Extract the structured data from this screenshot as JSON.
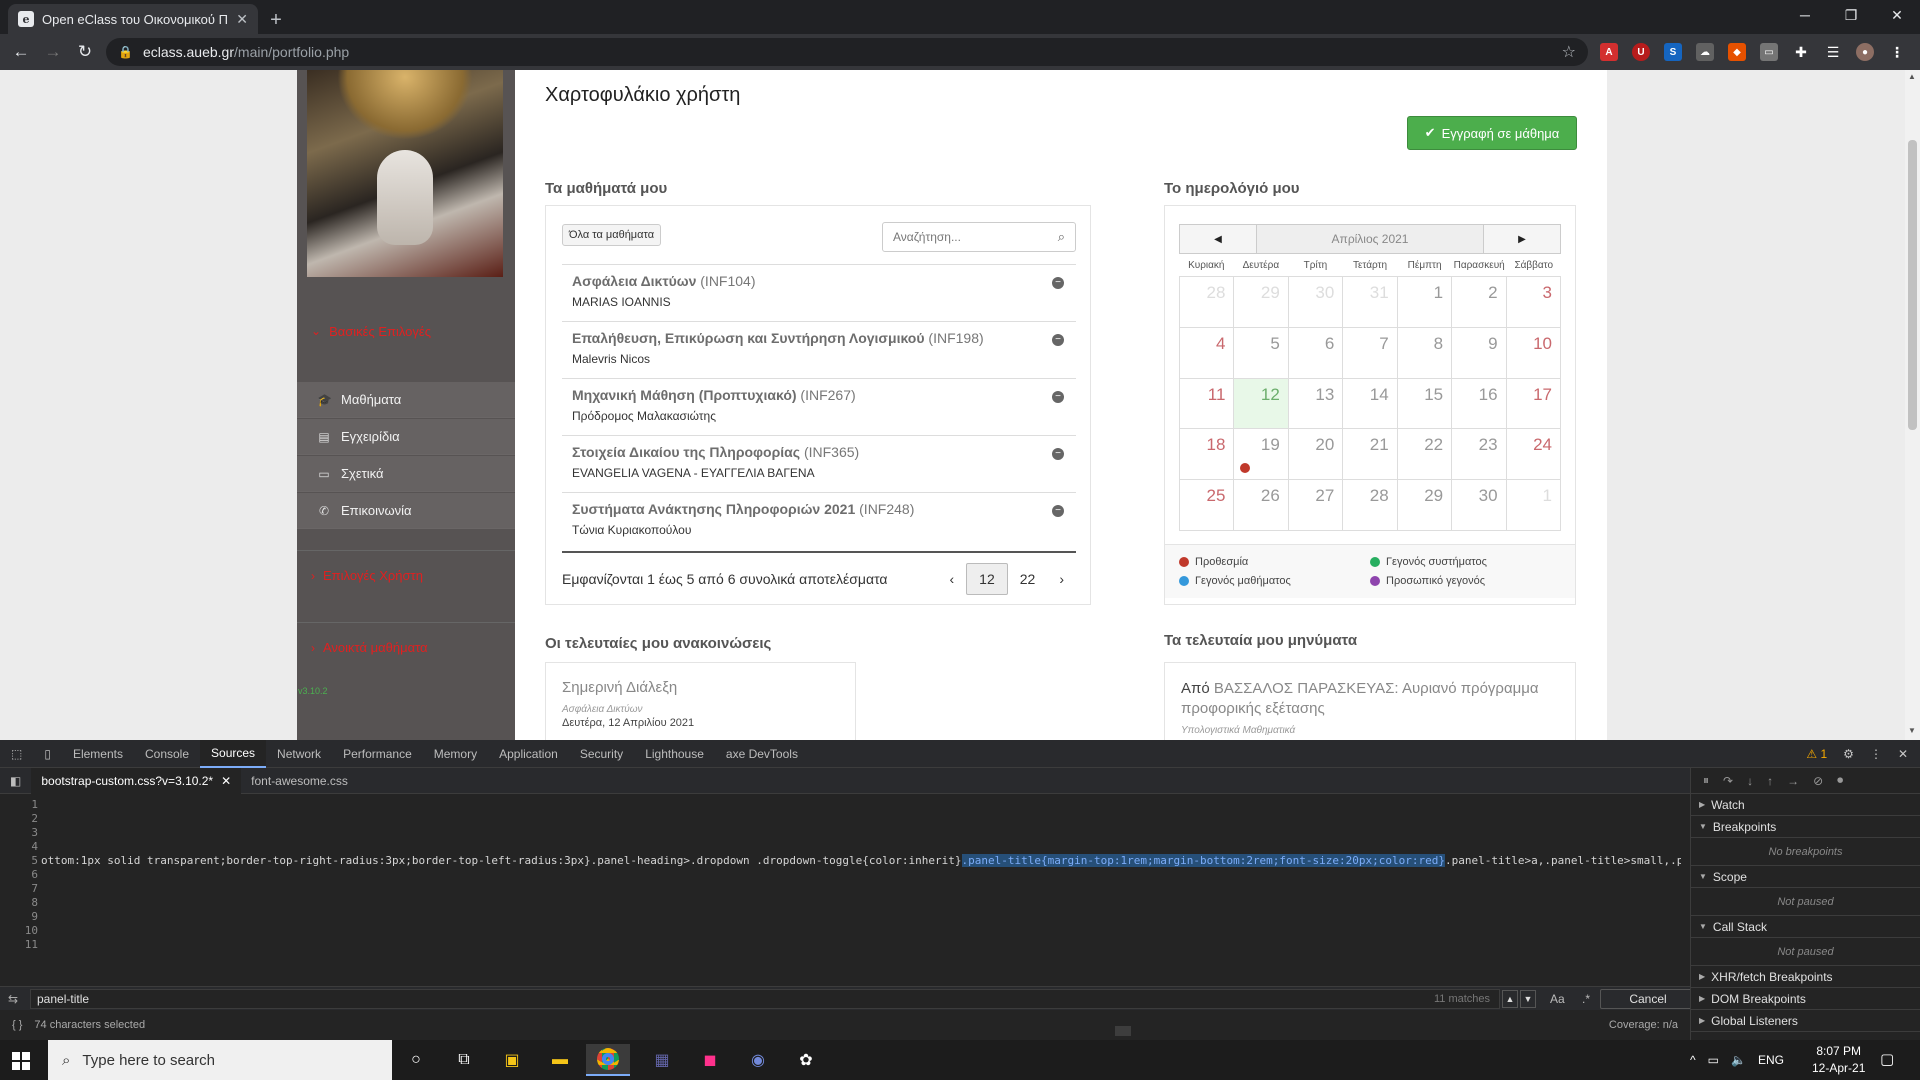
{
  "browser": {
    "tab_title": "Open eClass του Οικονομικού Π",
    "favicon_letter": "e",
    "url_host": "eclass.aueb.gr",
    "url_path": "/main/portfolio.php"
  },
  "sidebar": {
    "section_basic": "Βασικές Επιλογές",
    "items": [
      {
        "label": "Μαθήματα",
        "icon": "graduation-cap-icon"
      },
      {
        "label": "Εγχειρίδια",
        "icon": "book-icon"
      },
      {
        "label": "Σχετικά",
        "icon": "credit-card-icon"
      },
      {
        "label": "Επικοινωνία",
        "icon": "phone-icon"
      }
    ],
    "section_user": "Επιλογές Χρήστη",
    "section_open": "Ανοικτά μαθήματα",
    "version": "v3.10.2"
  },
  "main": {
    "page_title": "Χαρτοφυλάκιο χρήστη",
    "enroll_button": "Εγγραφή σε μάθημα",
    "my_courses_heading": "Τα μαθήματά μου",
    "all_courses_button": "Όλα τα μαθήματα",
    "search_placeholder": "Αναζήτηση...",
    "courses": [
      {
        "title": "Ασφάλεια Δικτύων",
        "code": "(INF104)",
        "professor": "MARIAS IOANNIS"
      },
      {
        "title": "Επαλήθευση, Επικύρωση και Συντήρηση Λογισμικού",
        "code": "(INF198)",
        "professor": "Malevris Nicos"
      },
      {
        "title": "Μηχανική Μάθηση (Προπτυχιακό)",
        "code": "(INF267)",
        "professor": "Πρόδρομος Μαλακασιώτης"
      },
      {
        "title": "Στοιχεία Δικαίου της Πληροφορίας",
        "code": "(INF365)",
        "professor": "EVANGELIA VAGENA - ΕΥΑΓΓΕΛΙΑ ΒΑΓΕΝΑ"
      },
      {
        "title": "Συστήματα Ανάκτησης Πληροφοριών 2021",
        "code": "(INF248)",
        "professor": "Τώνια Κυριακοπούλου"
      }
    ],
    "results_text": "Εμφανίζονται 1 έως 5 από 6 συνολικά αποτελέσματα",
    "pagination": {
      "prev": "‹",
      "page1": "12",
      "page2": "22",
      "next": "›"
    },
    "calendar_heading": "Το ημερολόγιό μου",
    "calendar": {
      "month": "Απρίλιος 2021",
      "prev": "◀",
      "next": "▶",
      "dows": [
        "Κυριακή",
        "Δευτέρα",
        "Τρίτη",
        "Τετάρτη",
        "Πέμπτη",
        "Παρασκευή",
        "Σάββατο"
      ],
      "days": [
        "28",
        "29",
        "30",
        "31",
        "1",
        "2",
        "3",
        "4",
        "5",
        "6",
        "7",
        "8",
        "9",
        "10",
        "11",
        "12",
        "13",
        "14",
        "15",
        "16",
        "17",
        "18",
        "19",
        "20",
        "21",
        "22",
        "23",
        "24",
        "25",
        "26",
        "27",
        "28",
        "29",
        "30",
        "1"
      ],
      "today": "12",
      "event_color": "#c0392b"
    },
    "legend": [
      {
        "label": "Προθεσμία",
        "color": "#c0392b"
      },
      {
        "label": "Γεγονός συστήματος",
        "color": "#27ae60"
      },
      {
        "label": "Γεγονός μαθήματος",
        "color": "#3498db"
      },
      {
        "label": "Προσωπικό γεγονός",
        "color": "#8e44ad"
      }
    ],
    "announcements_heading": "Οι τελευταίες μου ανακοινώσεις",
    "announcement": {
      "title": "Σημερινή Διάλεξη",
      "course": "Ασφάλεια Δικτύων",
      "date": "Δευτέρα, 12 Απριλίου 2021"
    },
    "messages_heading": "Τα τελευταία μου μηνύματα",
    "message": {
      "from_label": "Από",
      "sender": "ΒΑΣΣΑΛΟΣ ΠΑΡΑΣΚΕΥΑΣ:",
      "subject": "Αυριανό πρόγραμμα προφορικής εξέτασης",
      "course": "Υπολογιστικά Μαθηματικά"
    }
  },
  "devtools": {
    "tabs": [
      "Elements",
      "Console",
      "Sources",
      "Network",
      "Performance",
      "Memory",
      "Application",
      "Security",
      "Lighthouse",
      "axe DevTools"
    ],
    "warnings": "1",
    "files": [
      "bootstrap-custom.css?v=3.10.2*",
      "font-awesome.css"
    ],
    "line_numbers": [
      "1",
      "2",
      "3",
      "4",
      "5",
      "6",
      "7",
      "8",
      "9",
      "10",
      "11"
    ],
    "code_before": "ottom:1px solid transparent;border-top-right-radius:3px;border-top-left-radius:3px}.panel-heading>.dropdown .dropdown-toggle{color:inherit}",
    "code_selected": ".panel-title{margin-top:1rem;margin-bottom:2rem;font-size:20px;color:red}",
    "code_after": ".panel-title>a,.panel-title>small,.pa",
    "search_query": "panel-title",
    "match_count": "11 matches",
    "case_option": "Aa",
    "regex_option": ".*",
    "cancel_label": "Cancel",
    "status_text": "74 characters selected",
    "coverage": "Coverage: n/a",
    "side_sections": [
      {
        "label": "Watch",
        "open": false,
        "body": ""
      },
      {
        "label": "Breakpoints",
        "open": true,
        "body": "No breakpoints"
      },
      {
        "label": "Scope",
        "open": true,
        "body": "Not paused"
      },
      {
        "label": "Call Stack",
        "open": true,
        "body": "Not paused"
      },
      {
        "label": "XHR/fetch Breakpoints",
        "open": false,
        "body": ""
      },
      {
        "label": "DOM Breakpoints",
        "open": false,
        "body": ""
      },
      {
        "label": "Global Listeners",
        "open": false,
        "body": ""
      }
    ]
  },
  "taskbar": {
    "search_placeholder": "Type here to search",
    "lang": "ENG",
    "time": "8:07 PM",
    "date": "12-Apr-21"
  }
}
